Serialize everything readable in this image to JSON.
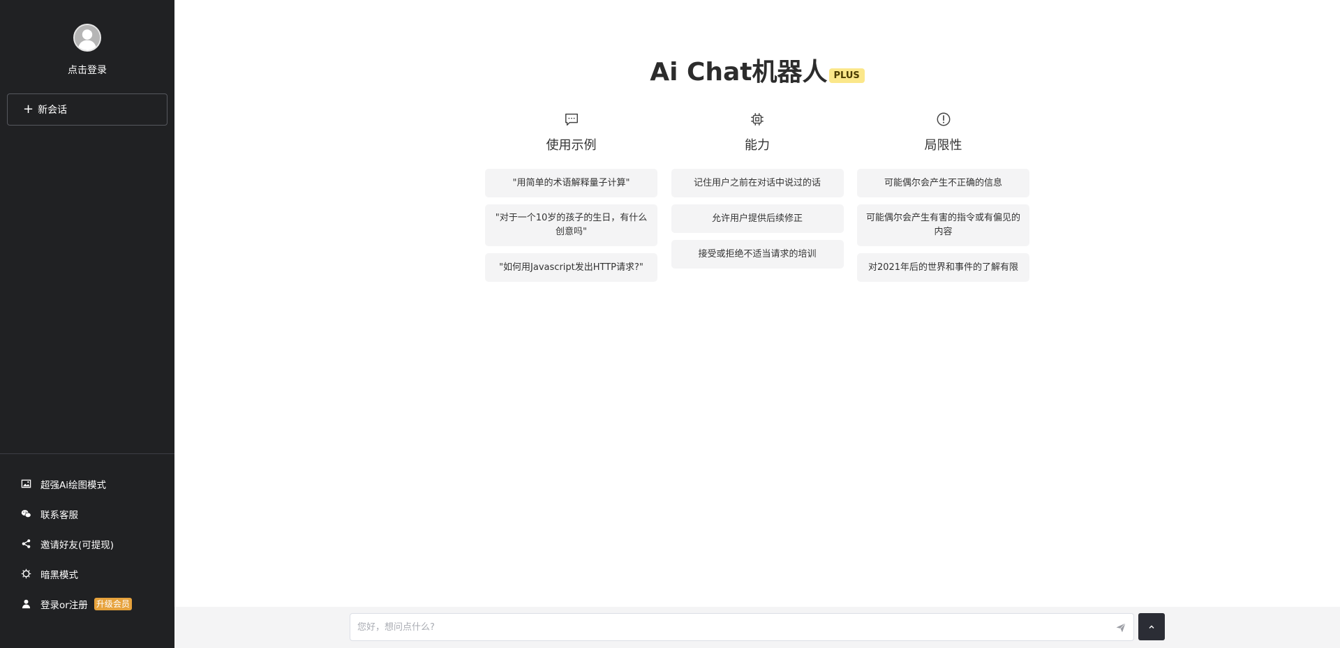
{
  "sidebar": {
    "login_link": "点击登录",
    "new_chat_label": "新会话",
    "menu": [
      {
        "label": "超强Ai绘图模式",
        "icon": "image-icon"
      },
      {
        "label": "联系客服",
        "icon": "wechat-icon"
      },
      {
        "label": "邀请好友(可提现)",
        "icon": "share-icon"
      },
      {
        "label": "暗黑模式",
        "icon": "sun-icon"
      },
      {
        "label": "登录or注册",
        "icon": "user-icon",
        "badge": "升级会员"
      }
    ]
  },
  "main": {
    "title": "Ai Chat机器人",
    "badge": "PLUS",
    "columns": [
      {
        "icon": "chat-bubble-icon",
        "title": "使用示例",
        "items": [
          "\"用简单的术语解释量子计算\"",
          "\"对于一个10岁的孩子的生日，有什么创意吗\"",
          "\"如何用Javascript发出HTTP请求?\""
        ]
      },
      {
        "icon": "cpu-icon",
        "title": "能力",
        "items": [
          "记住用户之前在对话中说过的话",
          "允许用户提供后续修正",
          "接受或拒绝不适当请求的培训"
        ]
      },
      {
        "icon": "alert-circle-icon",
        "title": "局限性",
        "items": [
          "可能偶尔会产生不正确的信息",
          "可能偶尔会产生有害的指令或有偏见的内容",
          "对2021年后的世界和事件的了解有限"
        ]
      }
    ]
  },
  "footer": {
    "input_placeholder": "您好，想问点什么?",
    "input_value": ""
  },
  "colors": {
    "sidebar_bg": "#202123",
    "plus_badge_bg": "#fbe78a",
    "vip_badge_bg": "#e6a23c",
    "footer_bg": "#f4f4f5",
    "card_bg": "#f4f4f5"
  }
}
